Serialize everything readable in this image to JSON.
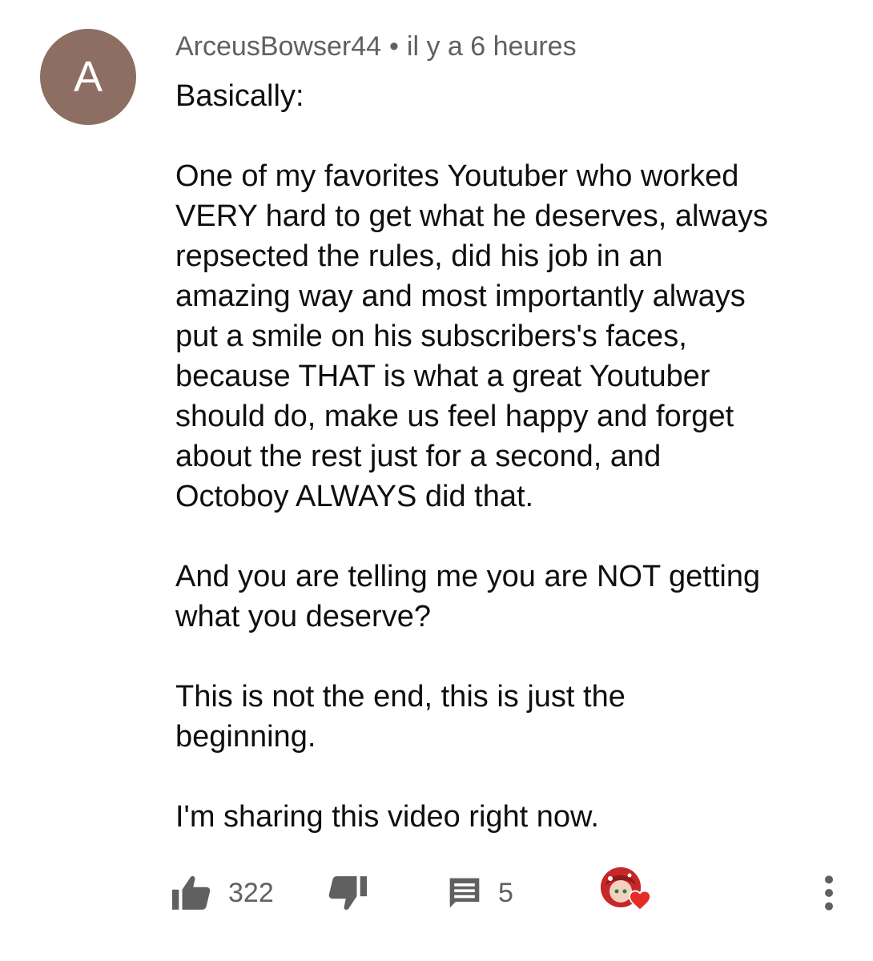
{
  "comment": {
    "avatar_letter": "A",
    "avatar_color": "#8d6e63",
    "author": "ArceusBowser44",
    "separator": "•",
    "timestamp": "il y a 6 heures",
    "paragraphs": [
      "Basically:",
      "One of my favorites Youtuber who worked\nVERY hard to get what he deserves, always\nrepsected the rules, did his job in an\namazing way and most importantly always\nput a smile on his subscribers's faces,\nbecause THAT is what a great Youtuber\nshould do, make us feel happy and forget\nabout the rest just for a second, and\nOctoboy ALWAYS did that.",
      "And you are telling me you are NOT getting\nwhat you deserve?",
      "This is not the end, this is just the\nbeginning.",
      "I'm sharing this video right now."
    ],
    "actions": {
      "like_icon": "thumbs-up-icon",
      "like_count": "322",
      "dislike_icon": "thumbs-down-icon",
      "reply_icon": "comment-icon",
      "reply_count": "5",
      "hearted_icon": "creator-heart-icon",
      "heart_color": "#e52d27",
      "more_icon": "more-vertical-icon"
    }
  }
}
